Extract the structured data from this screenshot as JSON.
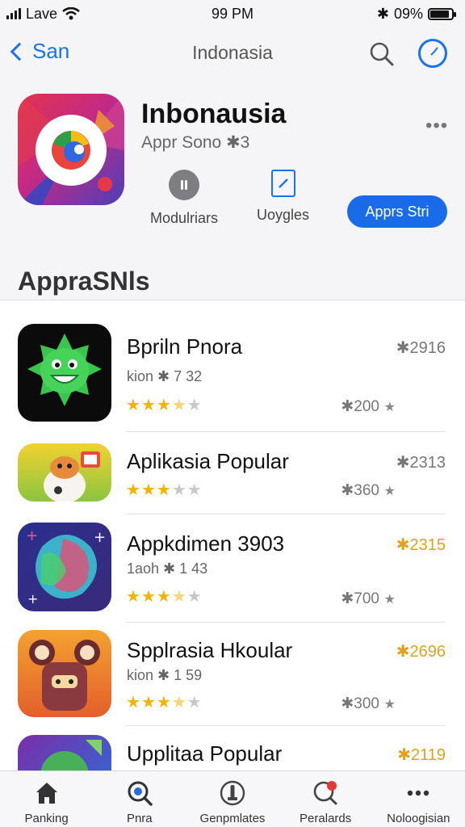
{
  "status_bar": {
    "carrier": "Lave",
    "time": "99 PM",
    "bluetooth": "✱",
    "battery_label": "09%",
    "battery_level": 0.9
  },
  "nav": {
    "back_label": "San",
    "title": "Indonasia",
    "search_icon": "search-icon",
    "compass_icon": "compass-icon"
  },
  "app_header": {
    "name": "Inbonausia",
    "subtitle": "Appr Sono ✱3",
    "more": "•••",
    "meta": [
      {
        "icon": "info-circle-icon",
        "label": "Modulriars"
      },
      {
        "icon": "edit-square-icon",
        "label": "Uoygles"
      }
    ],
    "get_button": "Apprs Stri"
  },
  "section": {
    "title": "AppraSNls"
  },
  "list": [
    {
      "title": "Bpriln Pnora",
      "subtitle": "kion ✱ 7 32",
      "rank": "✱2916",
      "rating": 3.5,
      "count": "✱200",
      "rank_color": "gray"
    },
    {
      "title": "Aplikasia Popular",
      "subtitle": "",
      "rank": "✱2313",
      "rating": 3,
      "count": "✱360",
      "rank_color": "gray"
    },
    {
      "title": "Appkdimen 3903",
      "subtitle": "1aoh ✱ 1 43",
      "rank": "✱2315",
      "rating": 3.5,
      "count": "✱700",
      "rank_color": "gold"
    },
    {
      "title": "Spplrasia Hkoular",
      "subtitle": "kion ✱ 1 59",
      "rank": "✱2696",
      "rating": 3.5,
      "count": "✱300",
      "rank_color": "gold"
    },
    {
      "title": "Upplitaa Popular",
      "subtitle": "",
      "rank": "✱2119",
      "rating": 0,
      "count": "",
      "rank_color": "gold"
    }
  ],
  "tabs": [
    {
      "label": "Panking",
      "icon": "home-icon"
    },
    {
      "label": "Pnra",
      "icon": "search-icon"
    },
    {
      "label": "Genpmlates",
      "icon": "apps-icon"
    },
    {
      "label": "Peralards",
      "icon": "notification-icon"
    },
    {
      "label": "Noloogisian",
      "icon": "more-icon"
    }
  ]
}
